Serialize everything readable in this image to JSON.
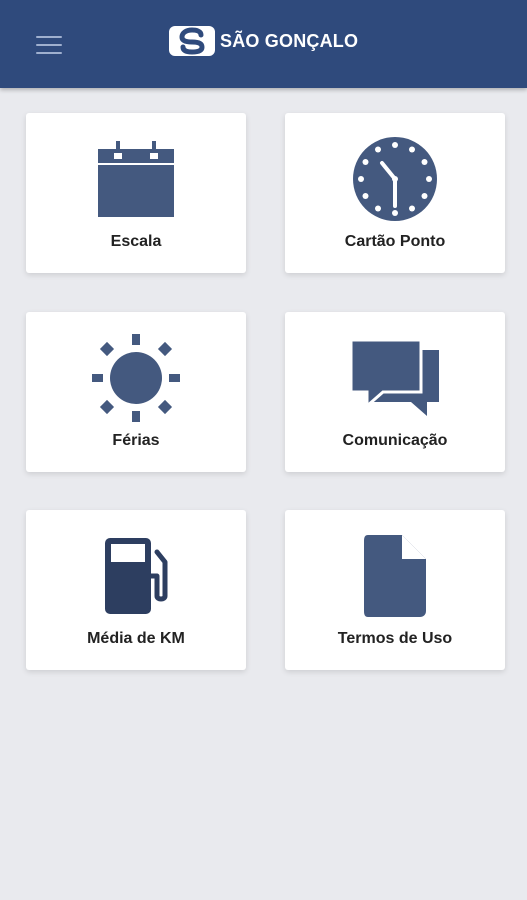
{
  "app": {
    "brand_name": "SÃO GONÇALO",
    "colors": {
      "appbar": "#2f4a7c",
      "icon": "#44597f",
      "background": "#e9eaee"
    }
  },
  "menu": [
    {
      "label": "Escala",
      "icon": "calendar-icon"
    },
    {
      "label": "Cartão Ponto",
      "icon": "clock-icon"
    },
    {
      "label": "Férias",
      "icon": "sun-icon"
    },
    {
      "label": "Comunicação",
      "icon": "chat-icon"
    },
    {
      "label": "Média de KM",
      "icon": "fuel-pump-icon"
    },
    {
      "label": "Termos de Uso",
      "icon": "document-icon"
    }
  ]
}
